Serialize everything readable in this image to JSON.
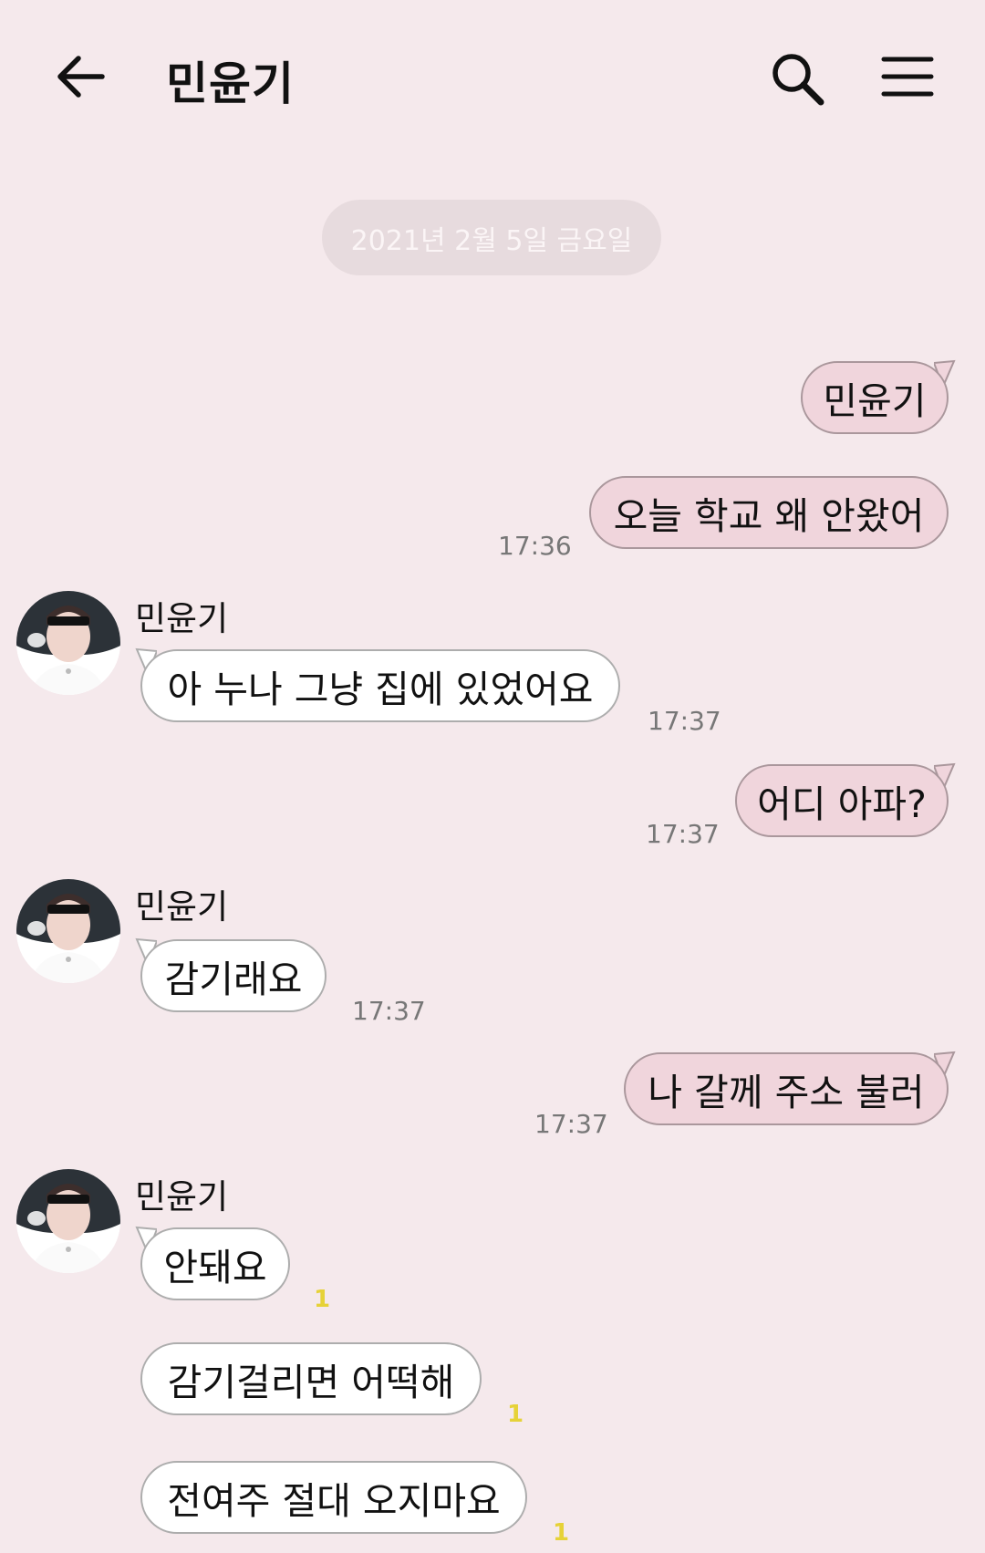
{
  "header": {
    "title": "민윤기"
  },
  "date_divider": "2021년 2월 5일 금요일",
  "messages": [
    {
      "text": "민윤기"
    },
    {
      "text": "오늘 학교 왜 안왔어",
      "time": "17:36"
    },
    {
      "sender": "민윤기",
      "text": "아 누나 그냥 집에 있었어요",
      "time": "17:37"
    },
    {
      "text": "어디 아파?",
      "time": "17:37"
    },
    {
      "sender": "민윤기",
      "text": "감기래요",
      "time": "17:37"
    },
    {
      "text": "나 갈께 주소 불러",
      "time": "17:37"
    },
    {
      "sender": "민윤기",
      "text": "안돼요",
      "unread": "1"
    },
    {
      "text": "감기걸리면 어떡해",
      "unread": "1"
    },
    {
      "text": "전여주 절대 오지마요",
      "unread": "1"
    }
  ],
  "colors": {
    "background": "#f5e9ec",
    "outgoing_bubble": "#f0d5dc",
    "incoming_bubble": "#ffffff",
    "unread_count": "#e6d238"
  },
  "icons": [
    "back-arrow-icon",
    "search-icon",
    "menu-icon"
  ]
}
